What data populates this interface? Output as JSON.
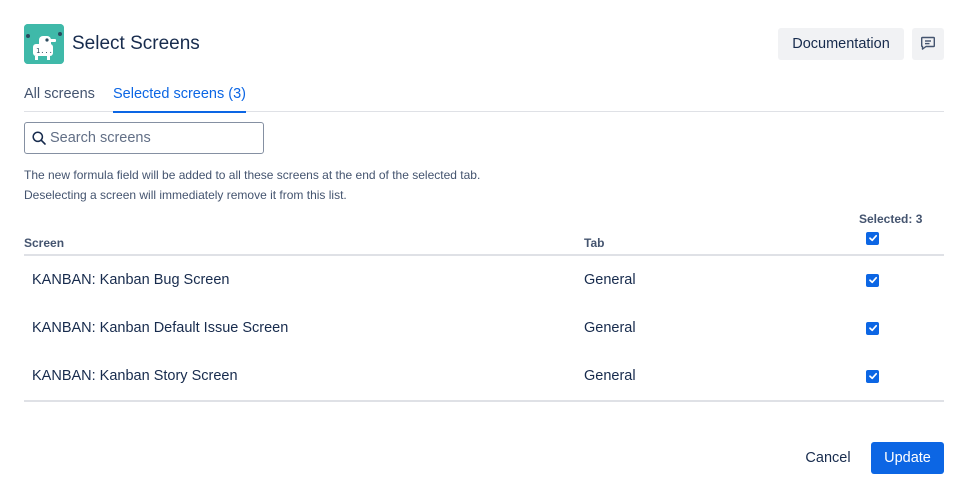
{
  "dialog": {
    "title": "Select Screens",
    "documentation_label": "Documentation",
    "feedback_icon": "comment-icon"
  },
  "tabs": [
    {
      "label": "All screens",
      "active": false
    },
    {
      "label": "Selected screens (3)",
      "active": true
    }
  ],
  "search": {
    "placeholder": "Search screens",
    "value": ""
  },
  "description": {
    "line1": "The new formula field will be added to all these screens at the end of the selected tab.",
    "line2": "Deselecting a screen will immediately remove it from this list."
  },
  "table": {
    "selected_count_label": "Selected: 3",
    "columns": {
      "screen": "Screen",
      "tab": "Tab"
    },
    "select_all_checked": true,
    "rows": [
      {
        "screen": "KANBAN: Kanban Bug Screen",
        "tab": "General",
        "checked": true
      },
      {
        "screen": "KANBAN: Kanban Default Issue Screen",
        "tab": "General",
        "checked": true
      },
      {
        "screen": "KANBAN: Kanban Story Screen",
        "tab": "General",
        "checked": true
      }
    ]
  },
  "footer": {
    "cancel_label": "Cancel",
    "update_label": "Update"
  },
  "colors": {
    "accent": "#0c66e4",
    "logo_bg": "#3fb9a9",
    "text": "#172b4d",
    "subtle_text": "#44546f",
    "border": "#dfe1e6"
  }
}
